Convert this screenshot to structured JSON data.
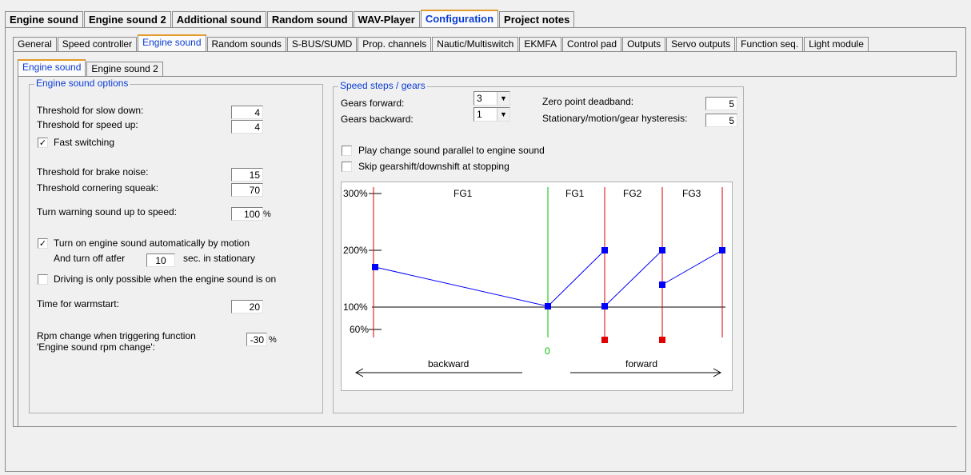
{
  "top_tabs": [
    {
      "label": "Engine sound",
      "active": false
    },
    {
      "label": "Engine sound 2",
      "active": false
    },
    {
      "label": "Additional sound",
      "active": false
    },
    {
      "label": "Random sound",
      "active": false
    },
    {
      "label": "WAV-Player",
      "active": false
    },
    {
      "label": "Configuration",
      "active": true
    },
    {
      "label": "Project notes",
      "active": false
    }
  ],
  "sub_tabs": [
    {
      "label": "General",
      "active": false
    },
    {
      "label": "Speed controller",
      "active": false
    },
    {
      "label": "Engine sound",
      "active": true
    },
    {
      "label": "Random sounds",
      "active": false
    },
    {
      "label": "S-BUS/SUMD",
      "active": false
    },
    {
      "label": "Prop. channels",
      "active": false
    },
    {
      "label": "Nautic/Multiswitch",
      "active": false
    },
    {
      "label": "EKMFA",
      "active": false
    },
    {
      "label": "Control pad",
      "active": false
    },
    {
      "label": "Outputs",
      "active": false
    },
    {
      "label": "Servo outputs",
      "active": false
    },
    {
      "label": "Function seq.",
      "active": false
    },
    {
      "label": "Light module",
      "active": false
    }
  ],
  "inner_tabs": [
    {
      "label": "Engine sound",
      "active": true
    },
    {
      "label": "Engine sound 2",
      "active": false
    }
  ],
  "options": {
    "title": "Engine sound options",
    "slow_down_label": "Threshold for slow down:",
    "slow_down_value": "4",
    "speed_up_label": "Threshold for speed up:",
    "speed_up_value": "4",
    "fast_switching_label": "Fast switching",
    "fast_switching_checked": true,
    "brake_label": "Threshold for brake noise:",
    "brake_value": "15",
    "cornering_label": "Threshold cornering squeak:",
    "cornering_value": "70",
    "warning_label": "Turn warning sound up to speed:",
    "warning_value": "100",
    "warning_unit": "%",
    "auto_on_label": "Turn on engine sound automatically by motion",
    "auto_on_checked": true,
    "auto_off_pre": "And turn off atfer",
    "auto_off_value": "10",
    "auto_off_post": "sec. in stationary",
    "driving_only_label": "Driving is only possible when the engine sound is on",
    "driving_only_checked": false,
    "warmstart_label": "Time for warmstart:",
    "warmstart_value": "20",
    "rpm_label_1": "Rpm change when triggering function",
    "rpm_label_2": "'Engine sound rpm change':",
    "rpm_value": "-30",
    "rpm_unit": "%"
  },
  "gears": {
    "title": "Speed steps / gears",
    "forward_label": "Gears forward:",
    "forward_value": "3",
    "backward_label": "Gears backward:",
    "backward_value": "1",
    "deadband_label": "Zero point deadband:",
    "deadband_value": "5",
    "hysteresis_label": "Stationary/motion/gear hysteresis:",
    "hysteresis_value": "5",
    "parallel_label": "Play change sound parallel to engine sound",
    "parallel_checked": false,
    "skip_label": "Skip gearshift/downshift at stopping",
    "skip_checked": false
  },
  "graph": {
    "y_labels": [
      "300%",
      "200%",
      "100%",
      "60%"
    ],
    "gear_labels": [
      "FG1",
      "FG1",
      "FG2",
      "FG3"
    ],
    "zero_label": "0",
    "backward_label": "backward",
    "forward_label": "forward",
    "colors": {
      "line": "#0000ff",
      "point": "#0000ff",
      "gear_line": "#e00000",
      "zero_line": "#00c000"
    }
  }
}
